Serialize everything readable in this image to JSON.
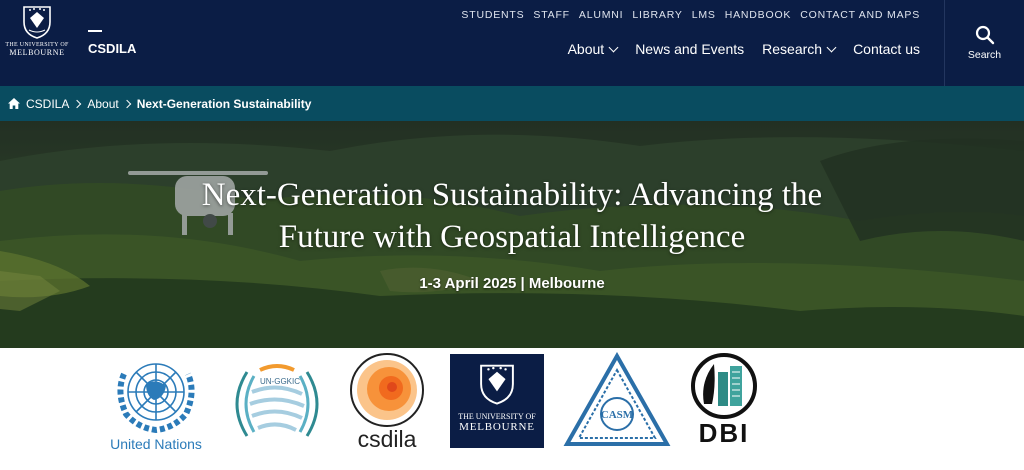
{
  "university": {
    "logo_line1": "THE UNIVERSITY OF",
    "logo_line2": "MELBOURNE"
  },
  "site": {
    "name": "CSDILA"
  },
  "utility_nav": [
    "STUDENTS",
    "STAFF",
    "ALUMNI",
    "LIBRARY",
    "LMS",
    "HANDBOOK",
    "CONTACT AND MAPS"
  ],
  "main_nav": {
    "about": "About",
    "news": "News and Events",
    "research": "Research",
    "contact": "Contact us"
  },
  "search": {
    "label": "Search"
  },
  "breadcrumb": {
    "home": "CSDILA",
    "parent": "About",
    "current": "Next-Generation Sustainability"
  },
  "hero": {
    "title_line1": "Next-Generation Sustainability: Advancing the",
    "title_line2": "Future with Geospatial Intelligence",
    "date": "1-3 April 2025 | Melbourne"
  },
  "partners": {
    "un_caption": "United Nations",
    "unggim_text": "UN-GGKIC",
    "csdila_caption": "csdila",
    "uom_line1": "THE UNIVERSITY OF",
    "uom_line2": "MELBOURNE",
    "casm_text": "CASM",
    "dbi_caption": "DBI"
  },
  "colors": {
    "header": "#0b1d45",
    "breadcrumb": "#094c60",
    "un_blue": "#2b7bb9",
    "csdila_orange": "#f47b20"
  }
}
